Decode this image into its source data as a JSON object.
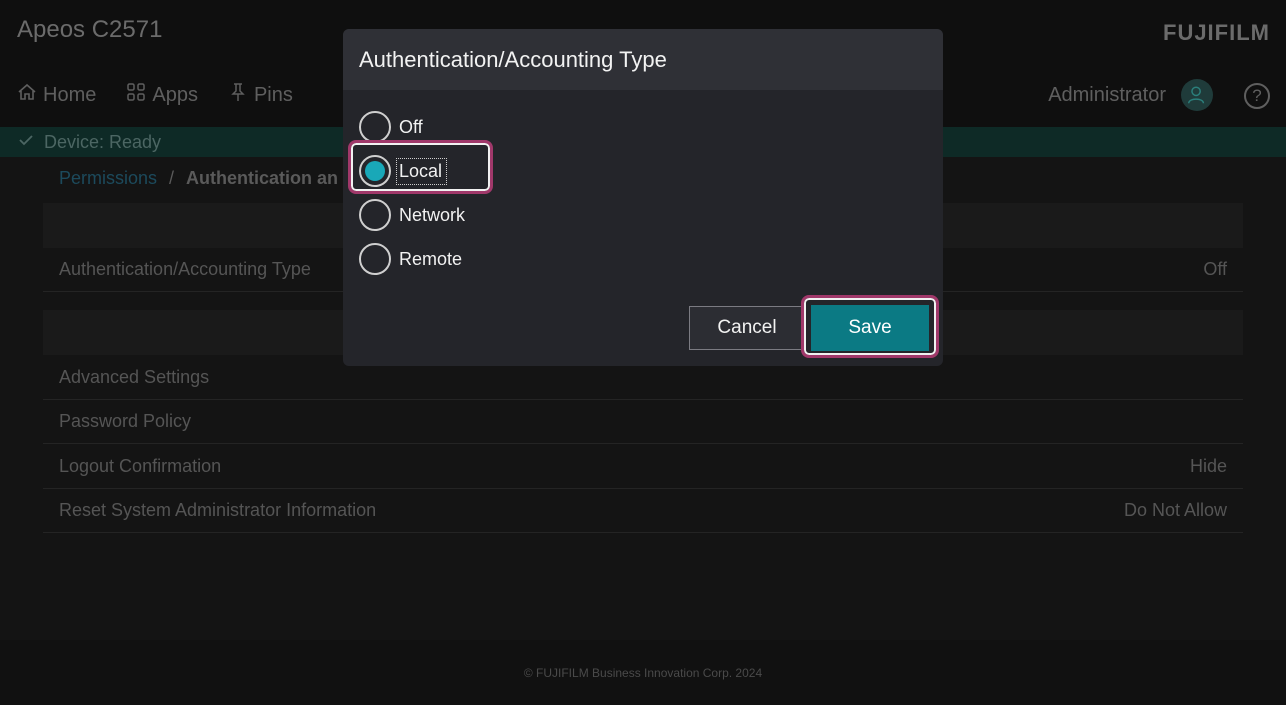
{
  "app": {
    "title": "Apeos C2571",
    "brand": "FUJIFILM",
    "nav": [
      {
        "label": "Home",
        "icon": "home-icon"
      },
      {
        "label": "Apps",
        "icon": "apps-grid-icon"
      },
      {
        "label": "Pins",
        "icon": "pin-icon"
      }
    ],
    "user": "Administrator",
    "status": "Device: Ready",
    "breadcrumb": {
      "parent": "Permissions",
      "separator": "/",
      "current": "Authentication an"
    },
    "rows": [
      {
        "label": "Authentication/Accounting Type",
        "value": "Off"
      },
      {
        "label": "Advanced Settings",
        "value": ""
      },
      {
        "label": "Password Policy",
        "value": ""
      },
      {
        "label": "Logout Confirmation",
        "value": "Hide"
      },
      {
        "label": "Reset System Administrator Information",
        "value": "Do Not Allow"
      }
    ],
    "footer": "© FUJIFILM Business Innovation Corp. 2024"
  },
  "dialog": {
    "title": "Authentication/Accounting Type",
    "options": [
      {
        "label": "Off",
        "selected": false
      },
      {
        "label": "Local",
        "selected": true
      },
      {
        "label": "Network",
        "selected": false
      },
      {
        "label": "Remote",
        "selected": false
      }
    ],
    "cancel_label": "Cancel",
    "save_label": "Save"
  },
  "colors": {
    "accent": "#19a8b8",
    "save_button": "#0b7a84",
    "highlight_border": "#a0386a"
  }
}
